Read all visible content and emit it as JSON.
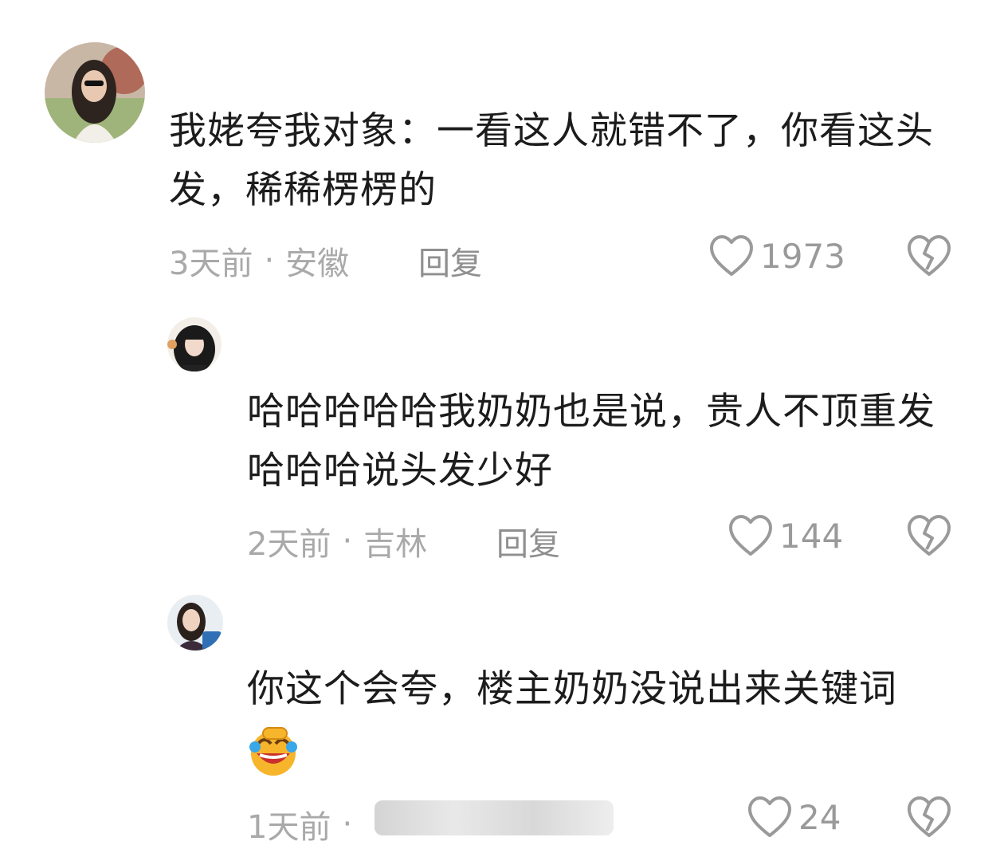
{
  "comments": [
    {
      "text": "我姥夸我对象：一看这人就错不了，你看这头发，稀稀楞楞的",
      "time": "3天前",
      "location": "安徽",
      "reply_label": "回复",
      "likes": "1973"
    },
    {
      "text": "哈哈哈哈哈我奶奶也是说，贵人不顶重发哈哈哈说头发少好",
      "time": "2天前",
      "location": "吉林",
      "reply_label": "回复",
      "likes": "144"
    },
    {
      "text": "你这个会夸，楼主奶奶没说出来关键词",
      "emoji": "rolling-on-floor-laughing",
      "time": "1天前",
      "likes": "24"
    }
  ],
  "meta_separator": "·",
  "icons": {
    "like": "heart-outline-icon",
    "dislike": "broken-heart-icon"
  }
}
